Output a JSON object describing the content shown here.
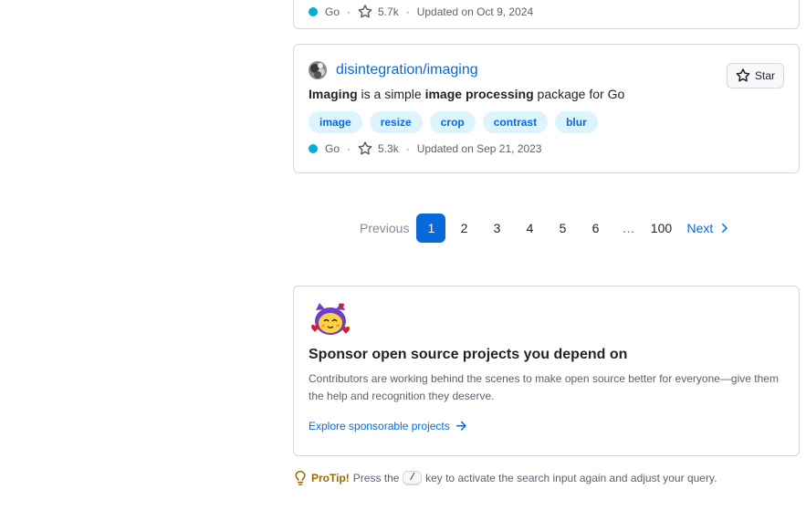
{
  "previous_result": {
    "language": "Go",
    "stars": "5.7k",
    "updated": "Updated on Oct 9, 2024"
  },
  "repo": {
    "name": "disintegration/imaging",
    "description": {
      "part1": "Imaging",
      "part2": " is a simple ",
      "part3": "image processing",
      "part4": " package for Go"
    },
    "topics": [
      "image",
      "resize",
      "crop",
      "contrast",
      "blur"
    ],
    "language": "Go",
    "language_color": "#00add8",
    "stars": "5.3k",
    "updated": "Updated on Sep 21, 2023",
    "star_button_label": "Star"
  },
  "pagination": {
    "previous_label": "Previous",
    "pages": [
      "1",
      "2",
      "3",
      "4",
      "5",
      "6"
    ],
    "gap": "…",
    "last": "100",
    "next_label": "Next",
    "current": "1"
  },
  "sponsor": {
    "title": "Sponsor open source projects you depend on",
    "body": "Contributors are working behind the scenes to make open source better for everyone—give them the help and recognition they deserve.",
    "link_label": "Explore sponsorable projects"
  },
  "protip": {
    "label": "ProTip!",
    "before": "Press the",
    "key": "/",
    "after": "key to activate the search input again and adjust your query."
  },
  "colors": {
    "accent": "#0969da",
    "topic_bg": "#ddf4ff",
    "muted": "#59636e",
    "protip": "#9a6700"
  },
  "icons": {
    "star": "star-icon",
    "chevron": "chevron-right-icon",
    "arrow": "arrow-right-icon",
    "bulb": "light-bulb-icon",
    "mona": "mona-hearts-icon"
  }
}
